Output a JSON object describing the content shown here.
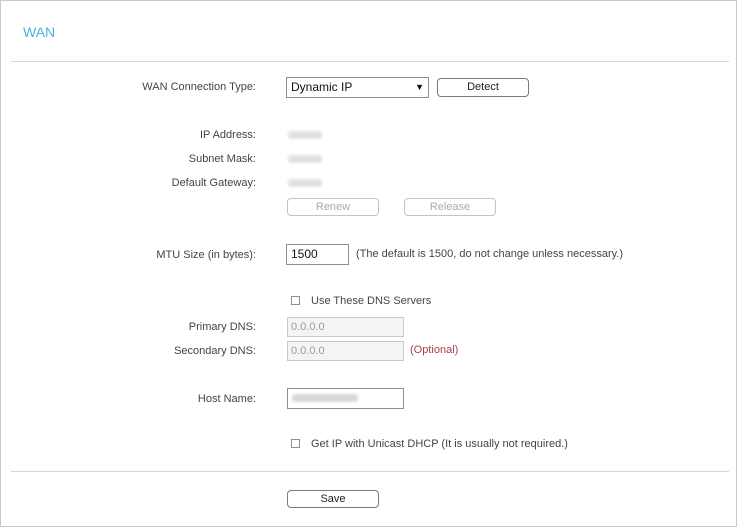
{
  "page": {
    "title": "WAN"
  },
  "form": {
    "connection_type_label": "WAN Connection Type:",
    "connection_type_value": "Dynamic IP",
    "detect_label": "Detect",
    "ip_address_label": "IP Address:",
    "subnet_mask_label": "Subnet Mask:",
    "default_gateway_label": "Default Gateway:",
    "renew_label": "Renew",
    "release_label": "Release",
    "mtu_label": "MTU Size (in bytes):",
    "mtu_value": "1500",
    "mtu_note": "(The default is 1500, do not change unless necessary.)",
    "use_dns_label": "Use These DNS Servers",
    "primary_dns_label": "Primary DNS:",
    "primary_dns_value": "0.0.0.0",
    "secondary_dns_label": "Secondary DNS:",
    "secondary_dns_value": "0.0.0.0",
    "optional_label": "(Optional)",
    "host_name_label": "Host Name:",
    "unicast_label": "Get IP with Unicast DHCP (It is usually not required.)",
    "save_label": "Save"
  },
  "colors": {
    "title": "#4bb3d6",
    "optional": "#b03a4a"
  }
}
